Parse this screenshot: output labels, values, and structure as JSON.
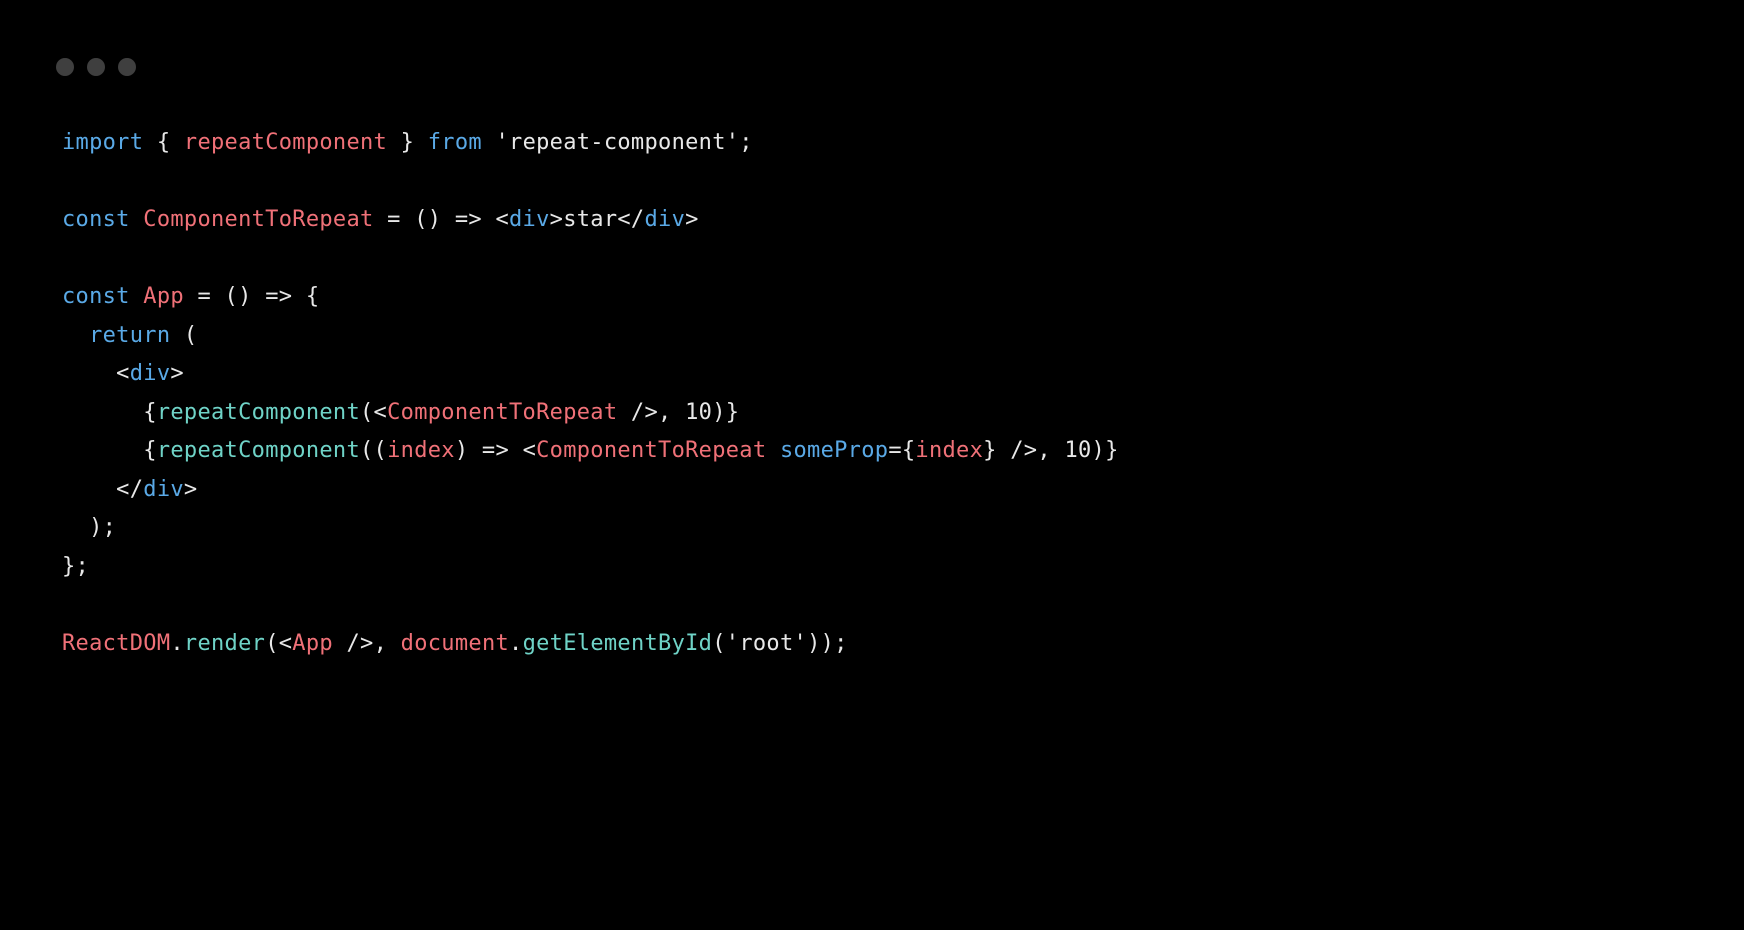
{
  "code": {
    "l1": {
      "t1": "import",
      "t2": " { ",
      "t3": "repeatComponent",
      "t4": " } ",
      "t5": "from",
      "t6": " ",
      "t7": "'repeat-component'",
      "t8": ";"
    },
    "l2": "",
    "l3": {
      "t1": "const",
      "t2": " ",
      "t3": "ComponentToRepeat",
      "t4": " = () => <",
      "t5": "div",
      "t6": ">star</",
      "t7": "div",
      "t8": ">"
    },
    "l4": "",
    "l5": {
      "t1": "const",
      "t2": " ",
      "t3": "App",
      "t4": " = () => {"
    },
    "l6": {
      "t1": "  ",
      "t2": "return",
      "t3": " ("
    },
    "l7": {
      "t1": "    <",
      "t2": "div",
      "t3": ">"
    },
    "l8": {
      "t1": "      {",
      "t2": "repeatComponent",
      "t3": "(<",
      "t4": "ComponentToRepeat",
      "t5": " />, ",
      "t6": "10",
      "t7": ")}"
    },
    "l9": {
      "t1": "      {",
      "t2": "repeatComponent",
      "t3": "((",
      "t4": "index",
      "t5": ") => <",
      "t6": "ComponentToRepeat",
      "t7": " ",
      "t8": "someProp",
      "t9": "={",
      "t10": "index",
      "t11": "} />, ",
      "t12": "10",
      "t13": ")}"
    },
    "l10": {
      "t1": "    </",
      "t2": "div",
      "t3": ">"
    },
    "l11": {
      "t1": "  );"
    },
    "l12": {
      "t1": "};"
    },
    "l13": "",
    "l14": {
      "t1": "ReactDOM",
      "t2": ".",
      "t3": "render",
      "t4": "(<",
      "t5": "App",
      "t6": " />, ",
      "t7": "document",
      "t8": ".",
      "t9": "getElementById",
      "t10": "(",
      "t11": "'root'",
      "t12": "));"
    }
  }
}
